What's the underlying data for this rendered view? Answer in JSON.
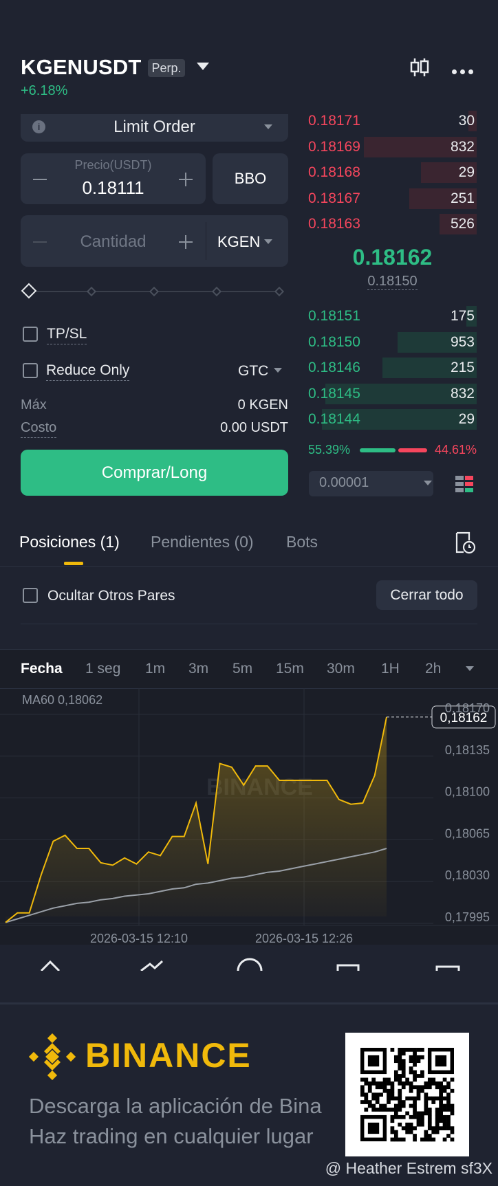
{
  "header": {
    "pair": "KGENUSDT",
    "badge": "Perp.",
    "change": "+6.18%"
  },
  "order_form": {
    "order_type": "Limit Order",
    "price_label": "Precio(USDT)",
    "price_value": "0.18111",
    "bbo_label": "BBO",
    "quantity_placeholder": "Cantidad",
    "quantity_unit": "KGEN",
    "tpsl_label": "TP/SL",
    "reduce_only_label": "Reduce Only",
    "time_in_force": "GTC",
    "max_label": "Máx",
    "max_value": "0 KGEN",
    "cost_label": "Costo",
    "cost_value": "0.00 USDT",
    "buy_button": "Comprar/Long"
  },
  "order_book": {
    "asks": [
      {
        "price": "0.18171",
        "qty": "30",
        "depth": 0.05
      },
      {
        "price": "0.18169",
        "qty": "832",
        "depth": 0.67
      },
      {
        "price": "0.18168",
        "qty": "29",
        "depth": 0.33
      },
      {
        "price": "0.18167",
        "qty": "251",
        "depth": 0.4
      },
      {
        "price": "0.18163",
        "qty": "526",
        "depth": 0.22
      }
    ],
    "mark_price": "0.18162",
    "index_price": "0.18150",
    "bids": [
      {
        "price": "0.18151",
        "qty": "175",
        "depth": 0.06
      },
      {
        "price": "0.18150",
        "qty": "953",
        "depth": 0.47
      },
      {
        "price": "0.18146",
        "qty": "215",
        "depth": 0.56
      },
      {
        "price": "0.18145",
        "qty": "832",
        "depth": 0.9
      },
      {
        "price": "0.18144",
        "qty": "29",
        "depth": 0.92
      }
    ],
    "buy_ratio": "55.39%",
    "sell_ratio": "44.61%",
    "precision": "0.00001"
  },
  "tabs": {
    "positions": "Posiciones (1)",
    "pending": "Pendientes (0)",
    "bots": "Bots"
  },
  "positions": {
    "hide_pairs_label": "Ocultar Otros Pares",
    "close_all_button": "Cerrar todo"
  },
  "timeframes": [
    "Fecha",
    "1 seg",
    "1m",
    "3m",
    "5m",
    "15m",
    "30m",
    "1H",
    "2h"
  ],
  "chart_data": {
    "type": "line",
    "title": "",
    "indicator_label": "MA60 0,18062",
    "current_price_label": "0,18162",
    "y_ticks": [
      "0,18170",
      "0,18135",
      "0,18100",
      "0,18065",
      "0,18030",
      "0,17995"
    ],
    "x_ticks": [
      "2026-03-15 12:10",
      "2026-03-15 12:26"
    ],
    "ylim": [
      0.17995,
      0.1817
    ],
    "watermark": "BINANCE",
    "series": [
      {
        "color": "#f0b90b",
        "values": [
          0.1799,
          0.17998,
          0.17998,
          0.1803,
          0.18058,
          0.18063,
          0.18052,
          0.18052,
          0.1804,
          0.18038,
          0.18044,
          0.18039,
          0.18049,
          0.18046,
          0.18062,
          0.18062,
          0.1809,
          0.18039,
          0.18123,
          0.1812,
          0.18105,
          0.18121,
          0.18121,
          0.18109,
          0.18109,
          0.18109,
          0.18109,
          0.18109,
          0.18093,
          0.18089,
          0.1809,
          0.18113,
          0.18162
        ]
      },
      {
        "color": "#9aa0a8",
        "values": [
          0.1799,
          0.17993,
          0.17996,
          0.17999,
          0.18002,
          0.18004,
          0.18006,
          0.18007,
          0.18009,
          0.1801,
          0.18012,
          0.18013,
          0.18014,
          0.18016,
          0.18018,
          0.18019,
          0.18022,
          0.18023,
          0.18025,
          0.18027,
          0.18028,
          0.1803,
          0.18032,
          0.18033,
          0.18035,
          0.18037,
          0.18039,
          0.18041,
          0.18043,
          0.18045,
          0.18047,
          0.18049,
          0.18052
        ]
      }
    ]
  },
  "footer": {
    "brand": "BINANCE",
    "download_line1": "Descarga la aplicación de Bina",
    "download_line2": "Haz trading en cualquier lugar",
    "watermark": "@ Heather Estrem sf3X"
  }
}
